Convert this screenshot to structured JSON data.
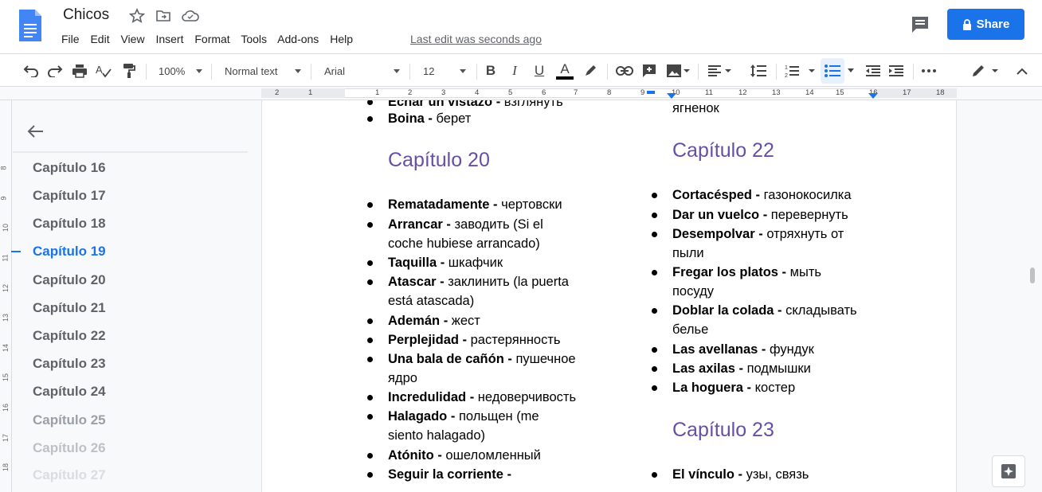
{
  "title": "Chicos",
  "menu": [
    "File",
    "Edit",
    "View",
    "Insert",
    "Format",
    "Tools",
    "Add-ons",
    "Help"
  ],
  "last_edit": "Last edit was seconds ago",
  "share_label": "Share",
  "toolbar": {
    "zoom": "100%",
    "style": "Normal text",
    "font": "Arial",
    "size": "12"
  },
  "ruler_numbers": [
    "2",
    "1",
    "1",
    "2",
    "3",
    "4",
    "5",
    "6",
    "7",
    "8",
    "9",
    "10",
    "11",
    "12",
    "13",
    "14",
    "15",
    "16",
    "17",
    "18"
  ],
  "vruler_numbers": [
    "8",
    "9",
    "10",
    "11",
    "12",
    "13",
    "14",
    "15",
    "16",
    "17",
    "18"
  ],
  "outline": {
    "items": [
      "Capítulo 16",
      "Capítulo 17",
      "Capítulo 18",
      "Capítulo 19",
      "Capítulo 20",
      "Capítulo 21",
      "Capítulo 22",
      "Capítulo 23",
      "Capítulo 24",
      "Capítulo 25",
      "Capítulo 26",
      "Capítulo 27"
    ],
    "active": "Capítulo 19"
  },
  "doc": {
    "left_top": [
      {
        "term": "Echar un vistazo",
        "sep": " - ",
        "tr": "взглянуть"
      },
      {
        "term": "Boina",
        "sep": " - ",
        "tr": "берет"
      }
    ],
    "h20": "Capítulo 20",
    "left_items": [
      {
        "term": "Rematadamente",
        "sep": " - ",
        "tr": "чертовски"
      },
      {
        "term": "Arrancar",
        "sep": " - ",
        "tr": "заводить (Si el",
        "tr2": "coche hubiese arrancado)"
      },
      {
        "term": "Taquilla",
        "sep": " - ",
        "tr": "шкафчик"
      },
      {
        "term": "Atascar",
        "sep": " - ",
        "tr": "заклинить (la puerta",
        "tr2": "está atascada)"
      },
      {
        "term": "Ademán",
        "sep": " - ",
        "tr": "жест"
      },
      {
        "term": "Perplejidad",
        "sep": " - ",
        "tr": "растерянность"
      },
      {
        "term": "Una bala de cañón",
        "sep": " - ",
        "tr": "пушечное",
        "tr2": "ядро"
      },
      {
        "term": "Incredulidad",
        "sep": " - ",
        "tr": "недоверчивость"
      },
      {
        "term": "Halagado",
        "sep": " - ",
        "tr": "польщен (me",
        "tr2": "siento halagado)"
      },
      {
        "term": "Atónito",
        "sep": " - ",
        "tr": "ошеломленный"
      },
      {
        "term": "Seguir la corriente",
        "sep": " - ",
        "tr": ""
      }
    ],
    "right_top": "ягненок",
    "h22": "Capítulo 22",
    "right_items": [
      {
        "term": "Cortacésped",
        "sep": "  - ",
        "tr": "газонокосилка"
      },
      {
        "term": "Dar un vuelco",
        "sep": " - ",
        "tr": "перевернуть"
      },
      {
        "term": "Desempolvar",
        "sep": " - ",
        "tr": "отряхнуть от",
        "tr2": "пыли"
      },
      {
        "term": "Fregar los platos",
        "sep": " - ",
        "tr": "мыть",
        "tr2": "посуду"
      },
      {
        "term": "Doblar la colada",
        "sep": " - ",
        "tr": "складывать",
        "tr2": "белье"
      },
      {
        "term": "Las avellanas",
        "sep": " - ",
        "tr": "фундук"
      },
      {
        "term": "Las axilas",
        "sep": " - ",
        "tr": "подмышки"
      },
      {
        "term": "La hoguera",
        "sep": " - ",
        "tr": "костер"
      }
    ],
    "h23": "Capítulo 23",
    "right_items2": [
      {
        "term": "El vínculo",
        "sep": " - ",
        "tr": "узы, связь"
      }
    ]
  },
  "colors": {
    "heading": "#674ea7",
    "accent": "#1a73e8"
  }
}
